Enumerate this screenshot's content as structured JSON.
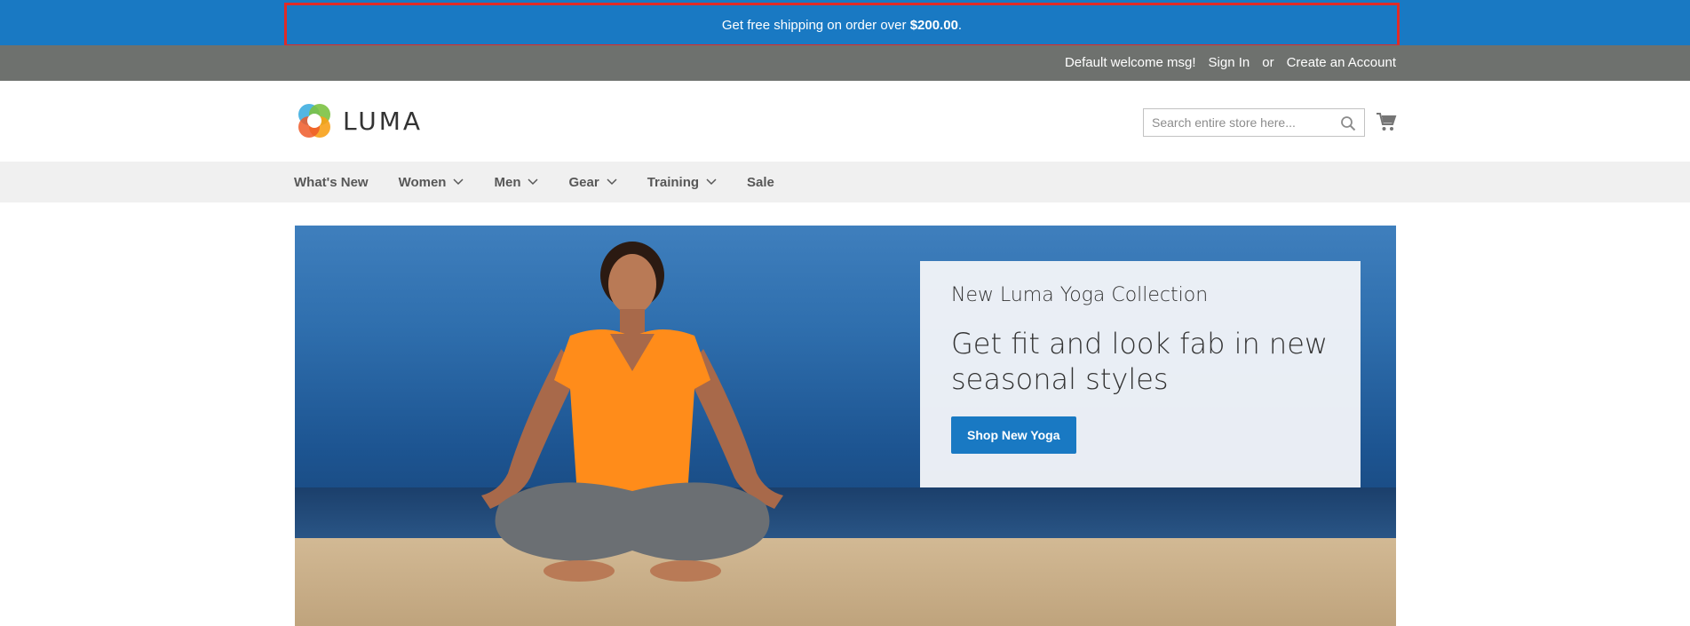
{
  "promo": {
    "text_before": "Get free shipping on order over ",
    "amount": "$200.00",
    "text_after": "."
  },
  "panel": {
    "welcome": "Default welcome msg!",
    "sign_in": "Sign In",
    "or": "or",
    "create_account": "Create an Account"
  },
  "header": {
    "logo_text": "LUMA",
    "search_placeholder": "Search entire store here...",
    "search_icon": "search-icon",
    "cart_icon": "cart-icon"
  },
  "nav": {
    "items": [
      {
        "label": "What's New",
        "has_dropdown": false
      },
      {
        "label": "Women",
        "has_dropdown": true
      },
      {
        "label": "Men",
        "has_dropdown": true
      },
      {
        "label": "Gear",
        "has_dropdown": true
      },
      {
        "label": "Training",
        "has_dropdown": true
      },
      {
        "label": "Sale",
        "has_dropdown": false
      }
    ]
  },
  "hero": {
    "subtitle": "New Luma Yoga Collection",
    "title": "Get fit and look fab in new seasonal styles",
    "button_label": "Shop New Yoga"
  },
  "colors": {
    "brand_blue": "#1979c3",
    "panel_gray": "#6e716e",
    "nav_gray": "#f0f0f0",
    "highlight_red": "#e02b27"
  }
}
